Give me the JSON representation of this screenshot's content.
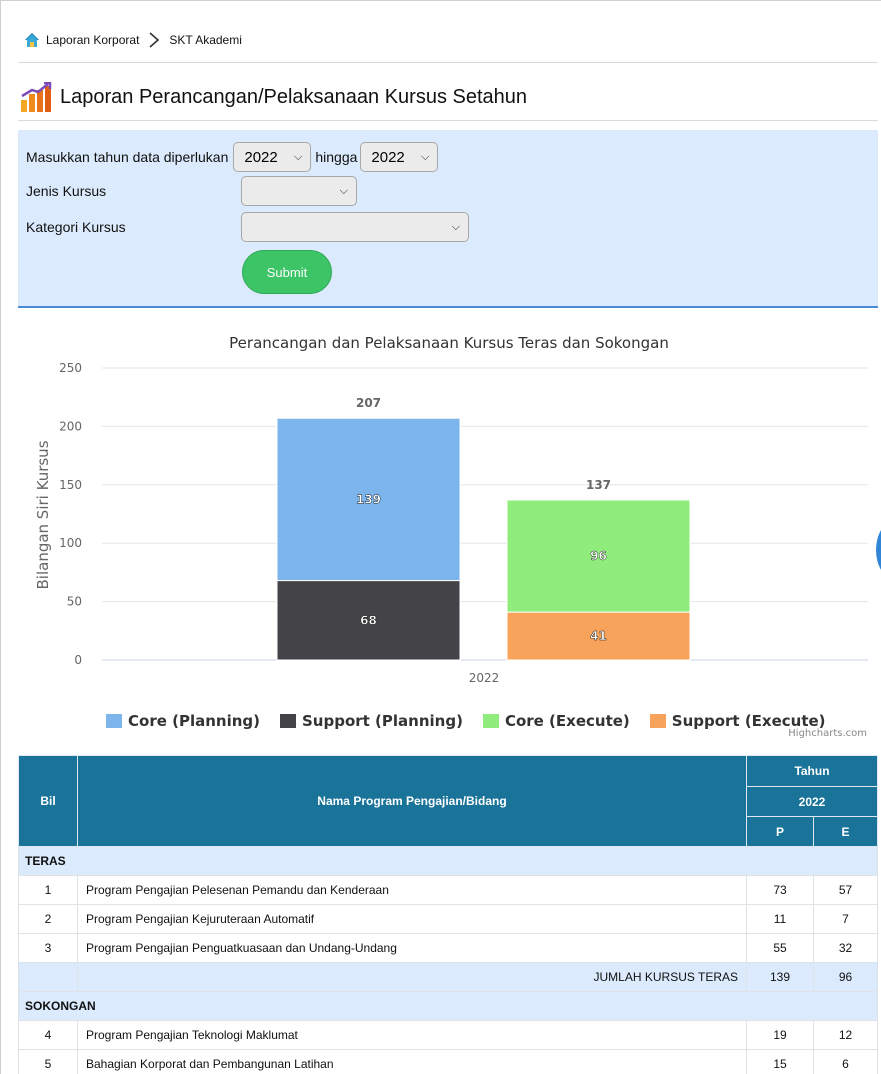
{
  "breadcrumb": {
    "home": "Laporan Korporat",
    "current": "SKT Akademi"
  },
  "page_title": "Laporan Perancangan/Pelaksanaan Kursus Setahun",
  "form": {
    "year_label": "Masukkan tahun data diperlukan",
    "year_from": "2022",
    "until_label": "hingga",
    "year_to": "2022",
    "jenis_label": "Jenis Kursus",
    "jenis_value": "",
    "kategori_label": "Kategori Kursus",
    "kategori_value": "",
    "submit_label": "Submit"
  },
  "chart_data": {
    "type": "bar",
    "title": "Perancangan dan Pelaksanaan Kursus Teras dan Sokongan",
    "xlabel": "",
    "ylabel": "Bilangan Siri Kursus",
    "categories": [
      "2022"
    ],
    "ylim": [
      0,
      250
    ],
    "yticks": [
      0,
      50,
      100,
      150,
      200,
      250
    ],
    "stacks": [
      {
        "total": 207,
        "series": [
          {
            "name": "Support (Planning)",
            "value": 68,
            "color": "#434348"
          },
          {
            "name": "Core (Planning)",
            "value": 139,
            "color": "#7cb5ec"
          }
        ]
      },
      {
        "total": 137,
        "series": [
          {
            "name": "Support (Execute)",
            "value": 41,
            "color": "#f7a35c"
          },
          {
            "name": "Core (Execute)",
            "value": 96,
            "color": "#90ed7d"
          }
        ]
      }
    ],
    "legend": [
      {
        "name": "Core (Planning)",
        "color": "#7cb5ec"
      },
      {
        "name": "Support (Planning)",
        "color": "#434348"
      },
      {
        "name": "Core (Execute)",
        "color": "#90ed7d"
      },
      {
        "name": "Support (Execute)",
        "color": "#f7a35c"
      }
    ],
    "grid": true,
    "legend_position": "bottom",
    "credits": "Highcharts.com"
  },
  "table": {
    "head_bil": "Bil",
    "head_name": "Nama Program Pengajian/Bidang",
    "head_tahun": "Tahun",
    "head_year": "2022",
    "head_p": "P",
    "head_e": "E",
    "groups": [
      {
        "name": "TERAS",
        "rows": [
          {
            "bil": "1",
            "name": "Program Pengajian Pelesenan Pemandu dan Kenderaan",
            "p": "73",
            "e": "57"
          },
          {
            "bil": "2",
            "name": "Program Pengajian Kejuruteraan Automatif",
            "p": "11",
            "e": "7"
          },
          {
            "bil": "3",
            "name": "Program Pengajian Penguatkuasaan dan Undang-Undang",
            "p": "55",
            "e": "32"
          }
        ],
        "total_label": "JUMLAH KURSUS TERAS",
        "total_p": "139",
        "total_e": "96"
      },
      {
        "name": "SOKONGAN",
        "rows": [
          {
            "bil": "4",
            "name": "Program Pengajian Teknologi Maklumat",
            "p": "19",
            "e": "12"
          },
          {
            "bil": "5",
            "name": "Bahagian Korporat dan Pembangunan Latihan",
            "p": "15",
            "e": "6"
          }
        ]
      }
    ]
  }
}
